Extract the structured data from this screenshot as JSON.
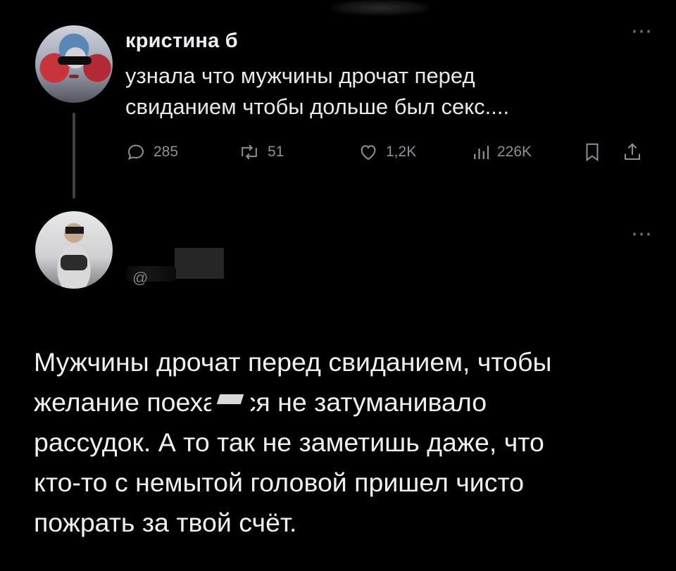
{
  "post": {
    "author_name": "кристина б",
    "text_lines": [
      "узнала что мужчины дрочат перед",
      "свиданием чтобы дольше был секс...."
    ],
    "more_icon": "ellipsis-icon",
    "actions": {
      "replies": "285",
      "reposts": "51",
      "likes": "1,2K",
      "views": "226K"
    }
  },
  "reply": {
    "handle_fragment": "@",
    "more_icon": "ellipsis-icon",
    "text_lines": [
      "Мужчины дрочат перед свиданием, чтобы",
      "желание поехаться не затуманивало",
      "рассудок. А то так не заметишь даже, что",
      "кто-то с немытой головой пришел чисто",
      "пожрать за твой счёт."
    ]
  },
  "colors": {
    "background": "#000000",
    "text": "#e7e9ea",
    "muted": "#8b9196"
  }
}
